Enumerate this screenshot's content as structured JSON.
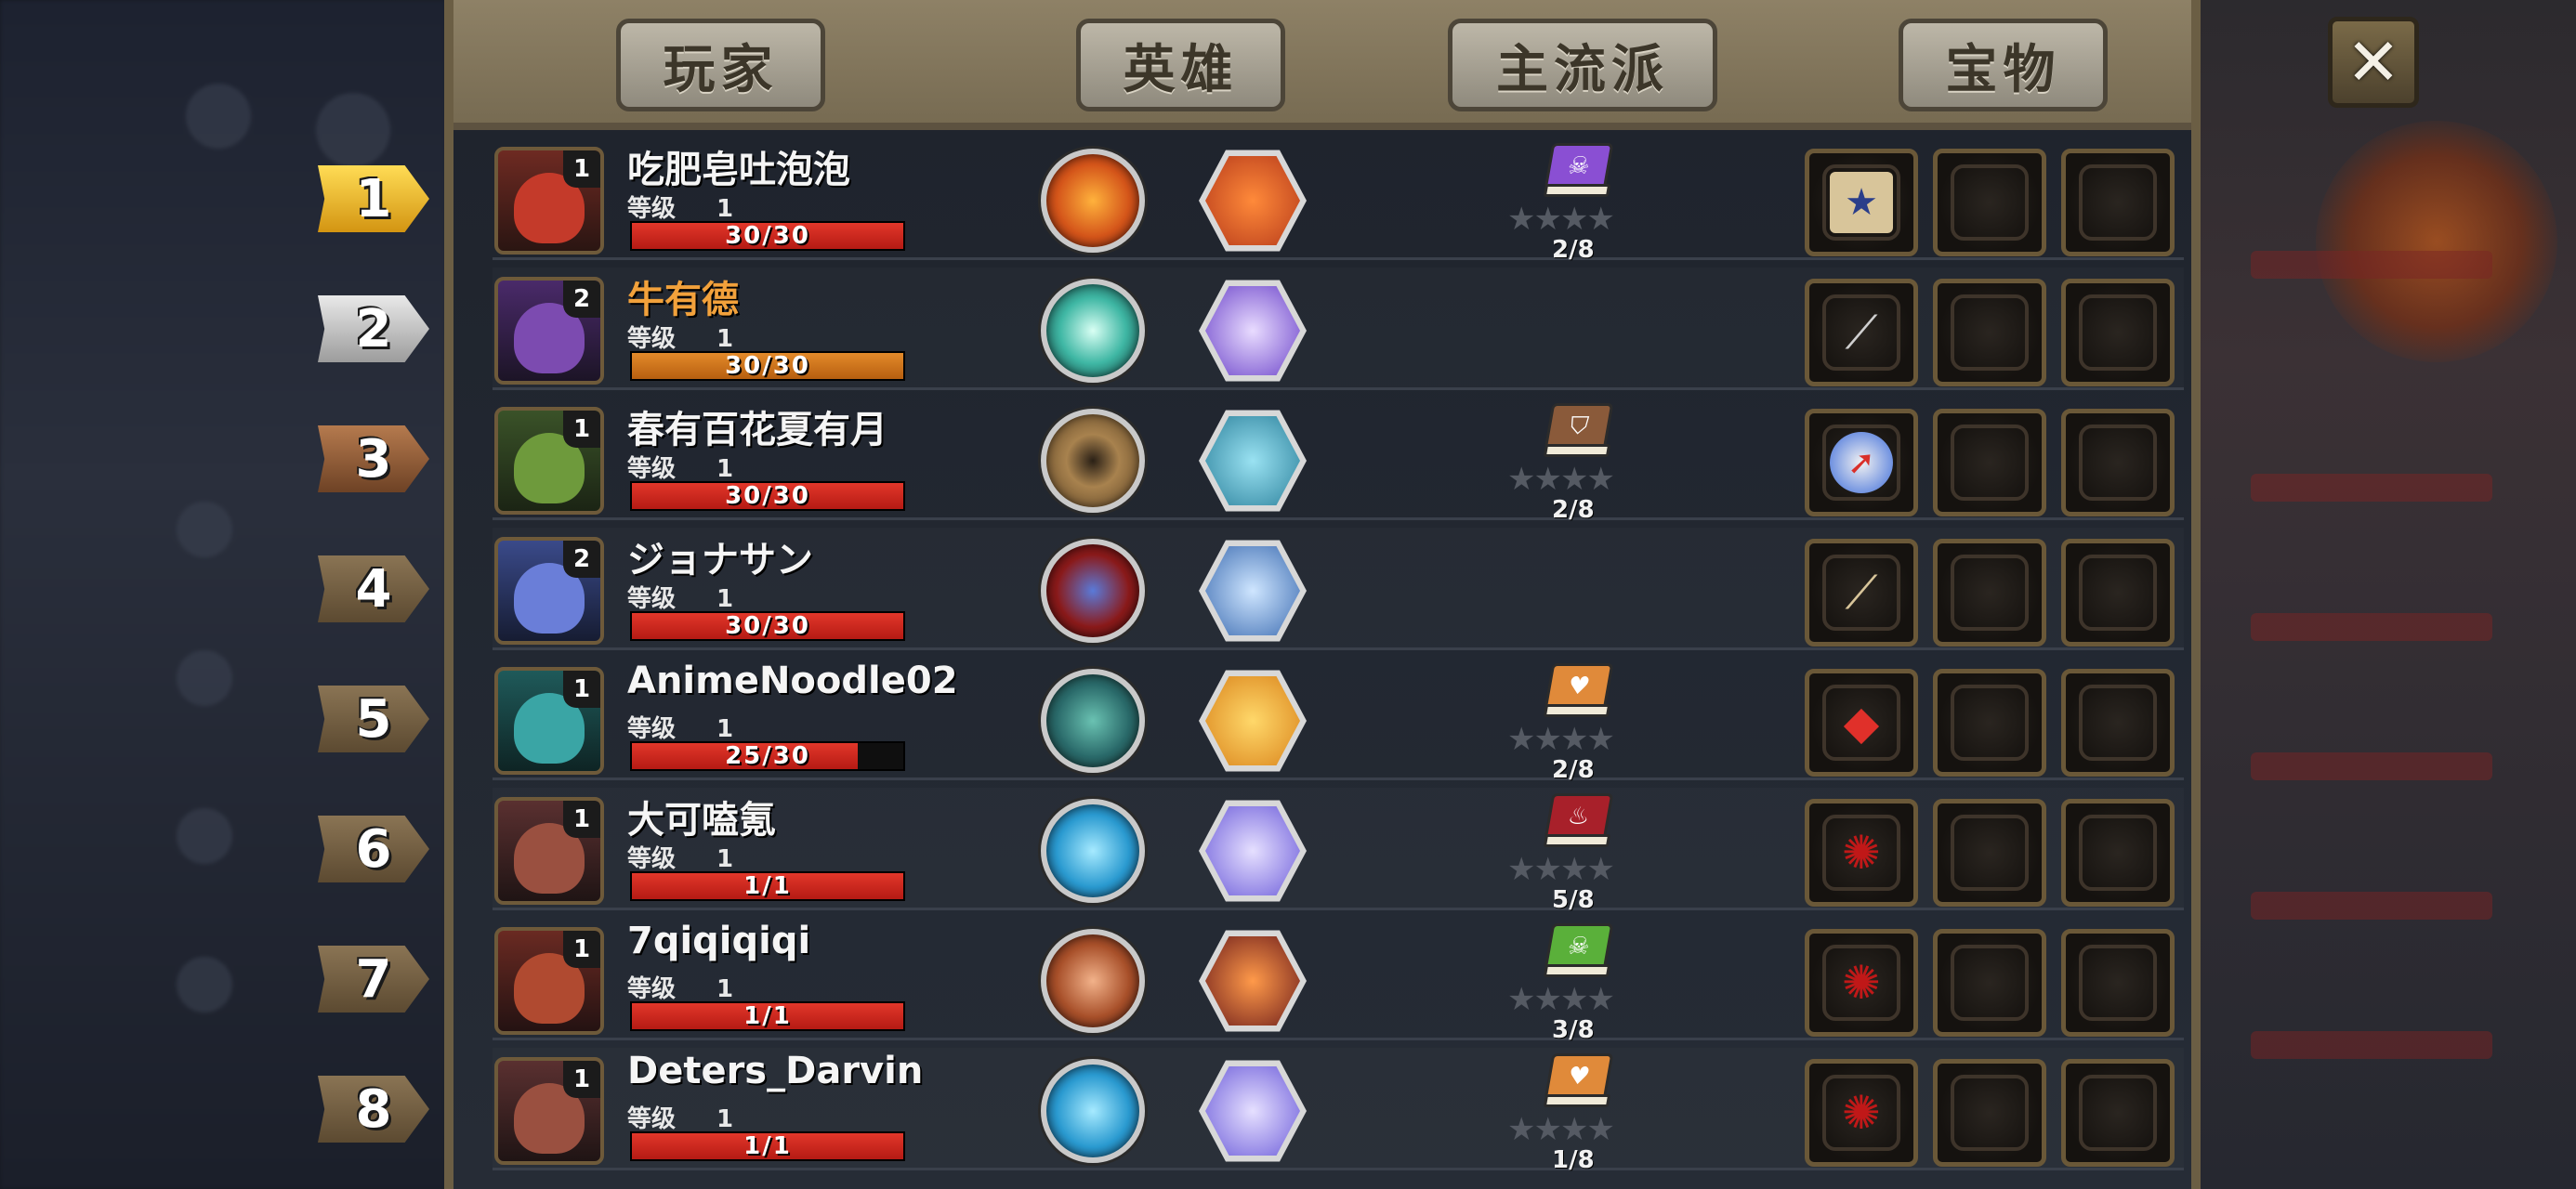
{
  "tabs": [
    {
      "label": "玩家"
    },
    {
      "label": "英雄"
    },
    {
      "label": "主流派"
    },
    {
      "label": "宝物"
    }
  ],
  "close_label": "✕",
  "level_label": "等级",
  "players": [
    {
      "rank": "1",
      "name": "吃肥皂吐泡泡",
      "level": "1",
      "hp_text": "30/30",
      "hp_fraction": 1.0,
      "tag": "1",
      "book_text": "2/8",
      "items": [
        "map-icon",
        "",
        ""
      ]
    },
    {
      "rank": "2",
      "name": "牛有德",
      "level": "1",
      "hp_text": "30/30",
      "hp_fraction": 1.0,
      "tag": "2",
      "book_text": "",
      "items": [
        "spear-icon",
        "",
        ""
      ]
    },
    {
      "rank": "3",
      "name": "春有百花夏有月",
      "level": "1",
      "hp_text": "30/30",
      "hp_fraction": 1.0,
      "tag": "1",
      "book_text": "2/8",
      "items": [
        "compass-icon",
        "",
        ""
      ]
    },
    {
      "rank": "4",
      "name": "ジョナサン",
      "level": "1",
      "hp_text": "30/30",
      "hp_fraction": 1.0,
      "tag": "2",
      "book_text": "",
      "items": [
        "halberd-icon",
        "",
        ""
      ]
    },
    {
      "rank": "5",
      "name": "AnimeNoodle02",
      "level": "1",
      "hp_text": "25/30",
      "hp_fraction": 0.8333,
      "tag": "1",
      "book_text": "2/8",
      "items": [
        "red-gem-icon",
        "",
        ""
      ]
    },
    {
      "rank": "6",
      "name": "大可嗑氪",
      "level": "1",
      "hp_text": "1/1",
      "hp_fraction": 1.0,
      "tag": "1",
      "book_text": "5/8",
      "items": [
        "dark-rune-icon",
        "",
        ""
      ]
    },
    {
      "rank": "7",
      "name": "7qiqiqiqi",
      "level": "1",
      "hp_text": "1/1",
      "hp_fraction": 1.0,
      "tag": "1",
      "book_text": "3/8",
      "items": [
        "dark-rune-icon",
        "",
        ""
      ]
    },
    {
      "rank": "8",
      "name": "Deters_Darvin",
      "level": "1",
      "hp_text": "1/1",
      "hp_fraction": 1.0,
      "tag": "1",
      "book_text": "1/8",
      "items": [
        "dark-rune-icon",
        "",
        ""
      ]
    }
  ]
}
